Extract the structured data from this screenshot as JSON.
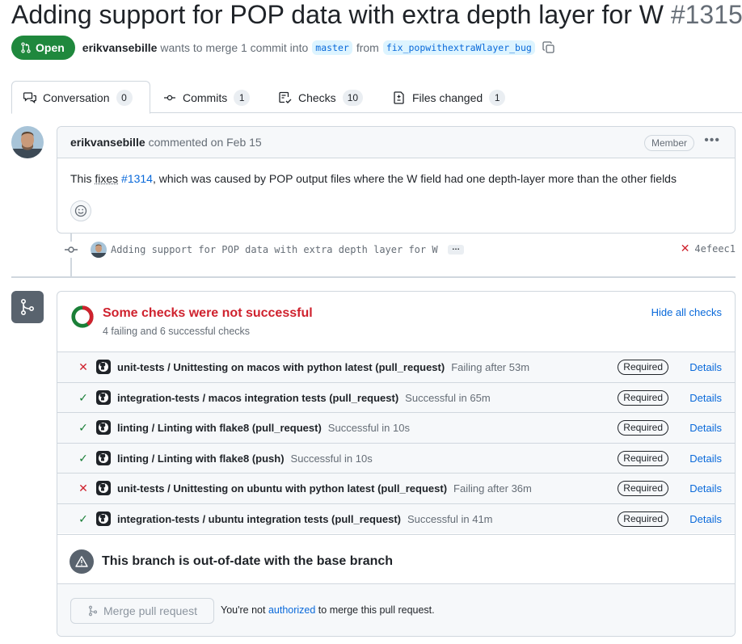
{
  "pr": {
    "title": "Adding support for POP data with extra depth layer for W",
    "number": "#1315",
    "state": "Open",
    "author": "erikvansebille",
    "merge_text": "wants to merge 1 commit into",
    "base_branch": "master",
    "from_text": "from",
    "head_branch": "fix_popwithextraWlayer_bug"
  },
  "tabs": [
    {
      "label": "Conversation",
      "count": "0",
      "icon": "comment-discussion-icon"
    },
    {
      "label": "Commits",
      "count": "1",
      "icon": "git-commit-icon"
    },
    {
      "label": "Checks",
      "count": "10",
      "icon": "checklist-icon"
    },
    {
      "label": "Files changed",
      "count": "1",
      "icon": "file-diff-icon"
    }
  ],
  "comment": {
    "author": "erikvansebille",
    "action": "commented on Feb 15",
    "badge": "Member",
    "body_before": "This",
    "body_fixes": "fixes",
    "body_issue": "#1314",
    "body_after": ", which was caused by POP output files where the W field had one depth-layer more than the other fields"
  },
  "commit": {
    "message": "Adding support for POP data with extra depth layer for W",
    "ellipsis": "…",
    "status": "failed",
    "sha": "4efeec1"
  },
  "checks": {
    "title": "Some checks were not successful",
    "summary": "4 failing and 6 successful checks",
    "hide_label": "Hide all checks",
    "colors": {
      "fail": "#cf222e",
      "success": "#1a7f37"
    },
    "items": [
      {
        "status": "fail",
        "name": "unit-tests / Unittesting on macos with python latest (pull_request)",
        "desc": "Failing after 53m",
        "badge": "Required",
        "link": "Details"
      },
      {
        "status": "pass",
        "name": "integration-tests / macos integration tests (pull_request)",
        "desc": "Successful in 65m",
        "badge": "Required",
        "link": "Details"
      },
      {
        "status": "pass",
        "name": "linting / Linting with flake8 (pull_request)",
        "desc": "Successful in 10s",
        "badge": "Required",
        "link": "Details"
      },
      {
        "status": "pass",
        "name": "linting / Linting with flake8 (push)",
        "desc": "Successful in 10s",
        "badge": "Required",
        "link": "Details"
      },
      {
        "status": "fail",
        "name": "unit-tests / Unittesting on ubuntu with python latest (pull_request)",
        "desc": "Failing after 36m",
        "badge": "Required",
        "link": "Details"
      },
      {
        "status": "pass",
        "name": "integration-tests / ubuntu integration tests (pull_request)",
        "desc": "Successful in 41m",
        "badge": "Required",
        "link": "Details"
      }
    ]
  },
  "merge": {
    "outofdate_title": "This branch is out-of-date with the base branch",
    "button_label": "Merge pull request",
    "note_before": "You're not",
    "note_link": "authorized",
    "note_after": "to merge this pull request."
  }
}
